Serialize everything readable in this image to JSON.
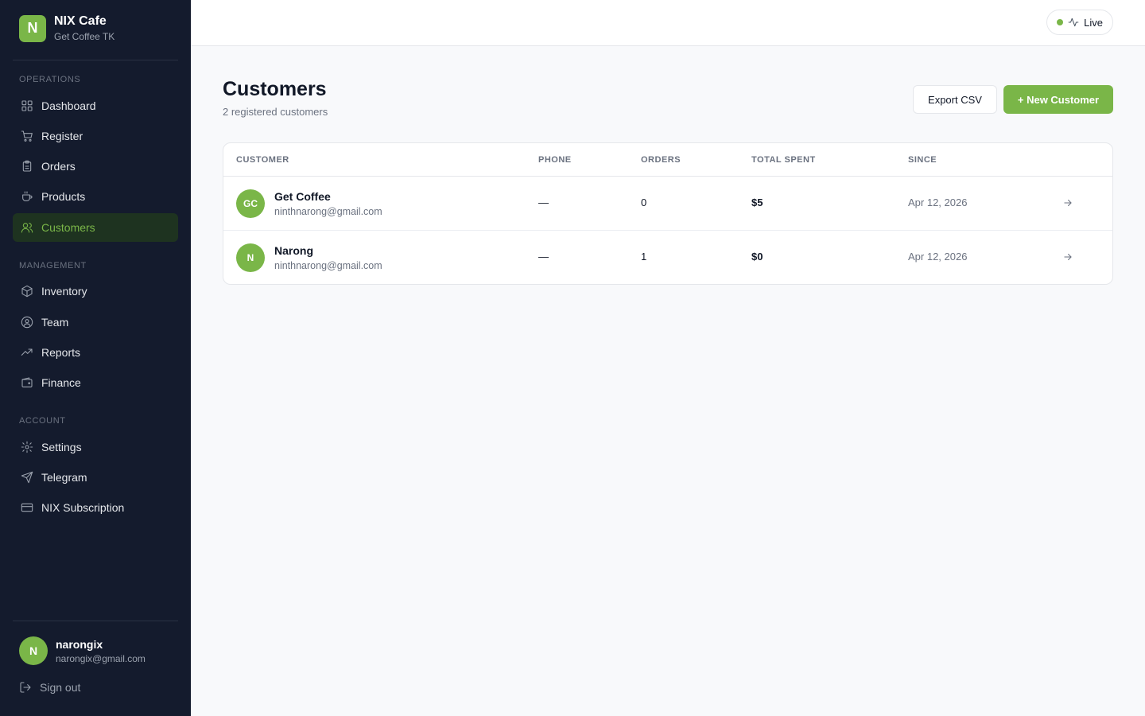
{
  "brand": {
    "initial": "N",
    "name": "NIX Cafe",
    "subtitle": "Get Coffee TK"
  },
  "sidebar": {
    "sections": [
      {
        "label": "OPERATIONS",
        "items": [
          {
            "label": "Dashboard",
            "icon": "grid-icon"
          },
          {
            "label": "Register",
            "icon": "cart-icon"
          },
          {
            "label": "Orders",
            "icon": "clipboard-icon"
          },
          {
            "label": "Products",
            "icon": "coffee-cup-icon"
          },
          {
            "label": "Customers",
            "icon": "users-icon",
            "active": true
          }
        ]
      },
      {
        "label": "MANAGEMENT",
        "items": [
          {
            "label": "Inventory",
            "icon": "package-icon"
          },
          {
            "label": "Team",
            "icon": "user-circle-icon"
          },
          {
            "label": "Reports",
            "icon": "trending-up-icon"
          },
          {
            "label": "Finance",
            "icon": "wallet-icon"
          }
        ]
      },
      {
        "label": "ACCOUNT",
        "items": [
          {
            "label": "Settings",
            "icon": "gear-icon"
          },
          {
            "label": "Telegram",
            "icon": "send-icon"
          },
          {
            "label": "NIX Subscription",
            "icon": "credit-card-icon"
          }
        ]
      }
    ]
  },
  "user": {
    "initial": "N",
    "name": "narongix",
    "email": "narongix@gmail.com"
  },
  "signout_label": "Sign out",
  "topbar": {
    "live_label": "Live"
  },
  "page": {
    "title": "Customers",
    "subtitle": "2 registered customers"
  },
  "actions": {
    "export_label": "Export CSV",
    "new_label": "+ New Customer"
  },
  "table": {
    "columns": [
      "CUSTOMER",
      "PHONE",
      "ORDERS",
      "TOTAL SPENT",
      "SINCE"
    ],
    "rows": [
      {
        "initials": "GC",
        "name": "Get Coffee",
        "email": "ninthnarong@gmail.com",
        "phone": "—",
        "orders": "0",
        "total_spent": "$5",
        "since": "Apr 12, 2026"
      },
      {
        "initials": "N",
        "name": "Narong",
        "email": "ninthnarong@gmail.com",
        "phone": "—",
        "orders": "1",
        "total_spent": "$0",
        "since": "Apr 12, 2026"
      }
    ]
  },
  "colors": {
    "accent": "#7ab648",
    "sidebar_bg": "#141b2d",
    "active_bg": "#1e3320"
  }
}
